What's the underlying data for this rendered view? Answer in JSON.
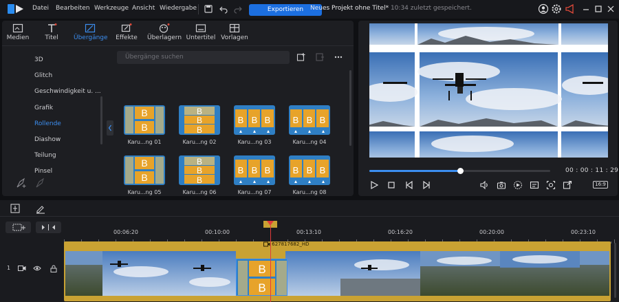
{
  "menu": {
    "items": [
      "Datei",
      "Bearbeiten",
      "Werkzeuge",
      "Ansicht",
      "Wiedergabe"
    ]
  },
  "toolbar": {
    "export_label": "Exportieren"
  },
  "project": {
    "title": "Neues Projekt ohne Titel*",
    "saved": "10:34 zuletzt gespeichert."
  },
  "tabs": [
    "Medien",
    "Titel",
    "Übergänge",
    "Effekte",
    "Überlagern",
    "Untertitel",
    "Vorlagen"
  ],
  "categories": [
    "3D",
    "Glitch",
    "Geschwindigkeit u. ...",
    "Grafik",
    "Rollende",
    "Diashow",
    "Teilung",
    "Pinsel"
  ],
  "search": {
    "placeholder": "Übergänge suchen"
  },
  "transitions": [
    "Karu...ng 01",
    "Karu...ng 02",
    "Karu...ng 03",
    "Karu...ng 04",
    "Karu...ng 05",
    "Karu...ng 06",
    "Karu...ng 07",
    "Karu...ng 08"
  ],
  "player": {
    "timecode": "00 : 00 : 11 : 29",
    "aspect": "16:9",
    "progress": 0.5
  },
  "timeline": {
    "ruler": [
      "00:06:20",
      "00:10:00",
      "00:13:10",
      "00:16:20",
      "00:20:00",
      "00:23:10"
    ],
    "track_number": "1",
    "clip_name": "627817682_HD"
  },
  "colors": {
    "accent": "#3c8ef0",
    "export": "#1c6fe0",
    "clip": "#c9a233",
    "playhead": "#e23b3b"
  }
}
